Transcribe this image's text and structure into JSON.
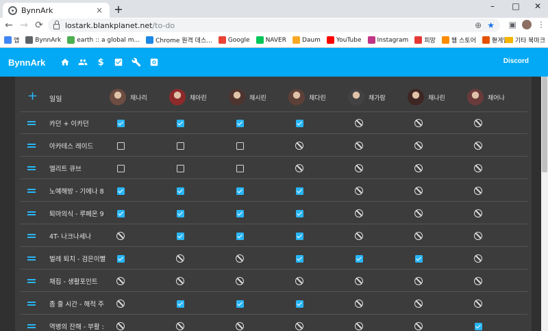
{
  "browser": {
    "tab_title": "BynnArk",
    "tab_close": "×",
    "new_tab": "+",
    "controls": [
      "–",
      "□",
      "✕"
    ],
    "nav": [
      "←",
      "→",
      "⟳"
    ],
    "url_host": "lostark.blankplanet.net",
    "url_path": "/to-do",
    "omnibox_icons": [
      "⊕",
      "★"
    ],
    "toolbar_icons": [
      "▣",
      "⋮"
    ]
  },
  "bookmarks": {
    "items": [
      {
        "label": "앱",
        "color": "#4285f4"
      },
      {
        "label": "BynnArk",
        "color": "#5f6368"
      },
      {
        "label": "earth :: a global m...",
        "color": "#4caf50"
      },
      {
        "label": "Chrome 원격 데스...",
        "color": "#1e88e5"
      },
      {
        "label": "Google",
        "color": "#ea4335"
      },
      {
        "label": "NAVER",
        "color": "#03c75a"
      },
      {
        "label": "Daum",
        "color": "#f9a825"
      },
      {
        "label": "YouTube",
        "color": "#ff0000"
      },
      {
        "label": "Instagram",
        "color": "#c13584"
      },
      {
        "label": "피망",
        "color": "#e53935"
      },
      {
        "label": "웹 스토어",
        "color": "#fb8c00"
      },
      {
        "label": "한게임",
        "color": "#e65100"
      }
    ],
    "more": "»",
    "folder": "기타 북마크"
  },
  "app": {
    "brand": "BynnArk",
    "discord": "Discord",
    "nav_icons": [
      "home-icon",
      "group-icon",
      "dollar-icon",
      "checkbox-icon",
      "wrench-icon",
      "settings-box-icon"
    ],
    "nav_dollar": "$",
    "add_symbol": "+"
  },
  "todo": {
    "header_label": "일일",
    "characters": [
      {
        "name": "채나리",
        "tone": "#6d4c41"
      },
      {
        "name": "채아린",
        "tone": "#8e2a2a"
      },
      {
        "name": "채시린",
        "tone": "#4e342e"
      },
      {
        "name": "채다린",
        "tone": "#5d4037"
      },
      {
        "name": "채가람",
        "tone": "#424242"
      },
      {
        "name": "채나린",
        "tone": "#3e2723"
      },
      {
        "name": "채어나",
        "tone": "#6a3b3b"
      }
    ],
    "tasks": [
      {
        "name": "카던 + 이카던",
        "cells": [
          "on",
          "on",
          "on",
          "on",
          "ban",
          "ban",
          "ban"
        ]
      },
      {
        "name": "아카테스 레이드",
        "cells": [
          "off",
          "off",
          "off",
          "ban",
          "ban",
          "ban",
          "ban"
        ]
      },
      {
        "name": "엘리트 큐브",
        "cells": [
          "off",
          "off",
          "off",
          "ban",
          "ban",
          "ban",
          "ban"
        ]
      },
      {
        "name": "노예해방 - 기에나 8",
        "cells": [
          "on",
          "on",
          "on",
          "on",
          "ban",
          "ban",
          "ban"
        ]
      },
      {
        "name": "퇴마의식 - 루페온 9",
        "cells": [
          "on",
          "on",
          "on",
          "on",
          "ban",
          "ban",
          "ban"
        ]
      },
      {
        "name": "4T- 나크나세나",
        "cells": [
          "ban",
          "on",
          "on",
          "on",
          "ban",
          "ban",
          "ban"
        ]
      },
      {
        "name": "벌레 퇴치 - 검은이빨",
        "cells": [
          "on",
          "ban",
          "ban",
          "on",
          "on",
          "on",
          "ban"
        ]
      },
      {
        "name": "채집 - 생활포인트",
        "cells": [
          "ban",
          "ban",
          "ban",
          "ban",
          "ban",
          "ban",
          "ban"
        ]
      },
      {
        "name": "좀 줄 시간 - 해적 주",
        "cells": [
          "ban",
          "on",
          "on",
          "on",
          "ban",
          "ban",
          "ban"
        ]
      },
      {
        "name": "역병의 잔해 - 부활 :",
        "cells": [
          "ban",
          "ban",
          "ban",
          "ban",
          "ban",
          "ban",
          "on"
        ]
      }
    ]
  }
}
